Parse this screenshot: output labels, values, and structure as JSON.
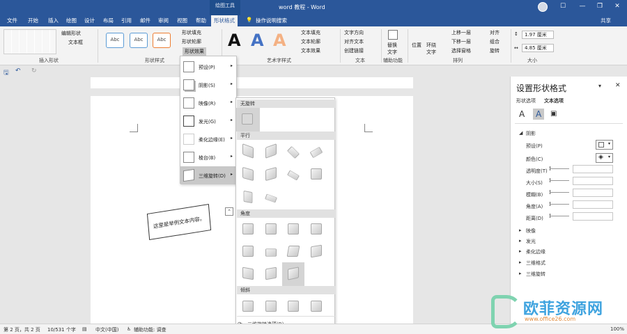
{
  "window": {
    "context_tab": "绘图工具",
    "title": "word 教程  -  Word",
    "share": "共享"
  },
  "window_controls": {
    "minimize": "—",
    "restore": "❐",
    "close": "✕",
    "account": "☐"
  },
  "tabs": [
    "文件",
    "开始",
    "插入",
    "绘图",
    "设计",
    "布局",
    "引用",
    "邮件",
    "审阅",
    "视图",
    "帮助",
    "形状格式"
  ],
  "tell_me": "操作说明搜索",
  "ribbon": {
    "insert_shapes": {
      "edit_shape": "编辑形状",
      "text_box": "文本框",
      "label": "插入形状"
    },
    "shape_styles": {
      "abc": [
        "Abc",
        "Abc",
        "Abc"
      ],
      "fill": "形状填充",
      "outline": "形状轮廓",
      "effects": "形状效果",
      "label": "形状样式"
    },
    "wordart": {
      "letters": [
        "A",
        "A",
        "A"
      ],
      "text_fill": "文本填充",
      "text_outline": "文本轮廓",
      "text_effects": "文本效果",
      "label": "艺术字样式"
    },
    "text": {
      "direction": "文字方向",
      "align": "对齐文本",
      "link": "创建链接",
      "label": "文本"
    },
    "accessibility": {
      "alt_text": "替换文字",
      "label": "辅助功能"
    },
    "arrange": {
      "position": "位置",
      "wrap": "环绕文字",
      "forward": "上移一层",
      "backward": "下移一层",
      "selection_pane": "选择窗格",
      "align": "对齐",
      "group": "组合",
      "rotate": "旋转",
      "label": "排列"
    },
    "size": {
      "height": "1.97 厘米",
      "width": "4.85 厘米",
      "label": "大小"
    }
  },
  "document": {
    "shape_text": "这里是举例文本内容。"
  },
  "effects_menu": [
    {
      "label": "预设(P)"
    },
    {
      "label": "阴影(S)"
    },
    {
      "label": "映像(R)"
    },
    {
      "label": "发光(G)"
    },
    {
      "label": "柔化边缘(E)"
    },
    {
      "label": "棱台(B)"
    },
    {
      "label": "三维旋转(D)"
    }
  ],
  "rotation_gallery": {
    "sections": [
      "无旋转",
      "平行",
      "角度",
      "倾斜"
    ],
    "footer": "三维旋转选项(R)..."
  },
  "format_pane": {
    "title": "设置形状格式",
    "tab_shape": "形状选项",
    "tab_text": "文本选项",
    "section_shadow": "阴影",
    "fields": [
      "预设(P)",
      "颜色(C)",
      "透明度(T)",
      "大小(S)",
      "模糊(B)",
      "角度(A)",
      "距离(D)"
    ],
    "collapsed": [
      "映像",
      "发光",
      "柔化边缘",
      "三维格式",
      "三维旋转"
    ]
  },
  "status": {
    "page": "第 2 页，共 2 页",
    "words": "10/531 个字",
    "lang": "中文(中国)",
    "access": "辅助功能: 调查",
    "zoom": "100%"
  },
  "watermark": {
    "title": "欧菲资源网",
    "url": "www.office26.com"
  }
}
